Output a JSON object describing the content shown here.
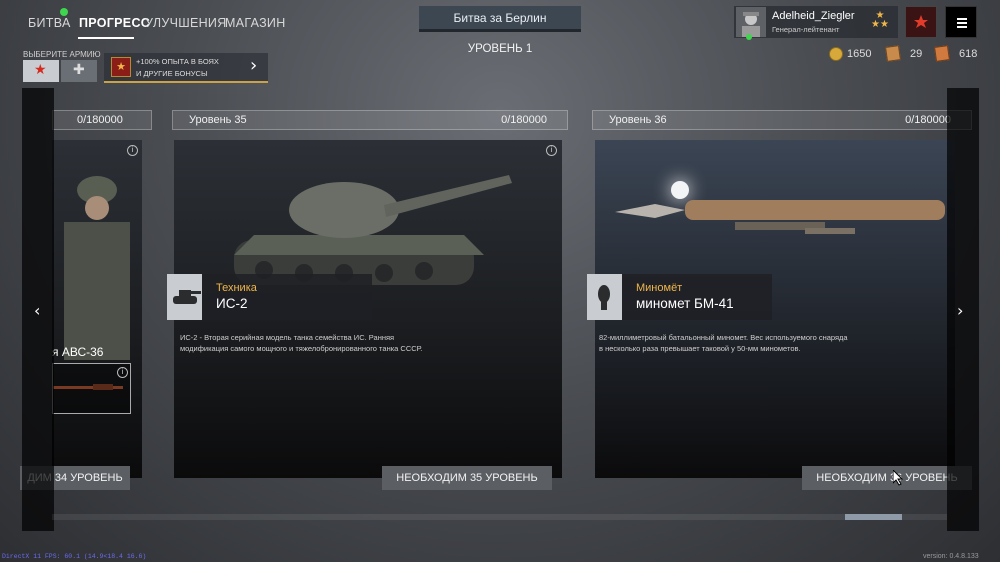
{
  "nav": {
    "battle": "БИТВА",
    "progress": "ПРОГРЕСС",
    "upgrades": "УЛУЧШЕНИЯ",
    "shop": "МАГАЗИН"
  },
  "mode": {
    "name": "Битва за Берлин",
    "level": "УРОВЕНЬ 1"
  },
  "profile": {
    "name": "Adelheid_Ziegler",
    "rank": "Генерал-лейтенант"
  },
  "army": {
    "label": "ВЫБЕРИТЕ АРМИЮ",
    "bonus_line1": "+100% ОПЫТА В БОЯХ",
    "bonus_line2": "И ДРУГИЕ БОНУСЫ"
  },
  "currency": {
    "silver": "1650",
    "cards_a": "29",
    "cards_b": "618"
  },
  "levels": [
    {
      "label": "",
      "progress": "0/180000"
    },
    {
      "label": "Уровень 35",
      "progress": "0/180000"
    },
    {
      "label": "Уровень 36",
      "progress": "0/180000"
    }
  ],
  "cards": [
    {
      "name": "я АВС-36",
      "requirement": "ДИМ 34 УРОВЕНЬ"
    },
    {
      "category": "Техника",
      "name": "ИС-2",
      "description": "ИС-2 - Вторая серийная модель танка семейства ИС. Ранняя модификация самого мощного и тяжелобронированного танка СССР.",
      "requirement": "НЕОБХОДИМ 35 УРОВЕНЬ"
    },
    {
      "category": "Миномёт",
      "name": "миномет БМ-41",
      "description": "82-миллиметровый батальонный миномет. Вес используемого снаряда в несколько раза превышает таковой у 50-мм минометов.",
      "requirement": "НЕОБХОДИМ 36 УРОВЕНЬ"
    }
  ],
  "icons": {
    "left": "chevron-left-icon",
    "right": "chevron-right-icon",
    "menu": "hamburger-menu-icon",
    "info": "info-icon"
  },
  "footer": {
    "debug": "DirectX 11 FPS: 60.1 (14.9<18.4 16.6)",
    "version": "version: 0.4.8.133"
  },
  "colors": {
    "accent": "#f0b64a",
    "status_online": "#3fd64f"
  }
}
